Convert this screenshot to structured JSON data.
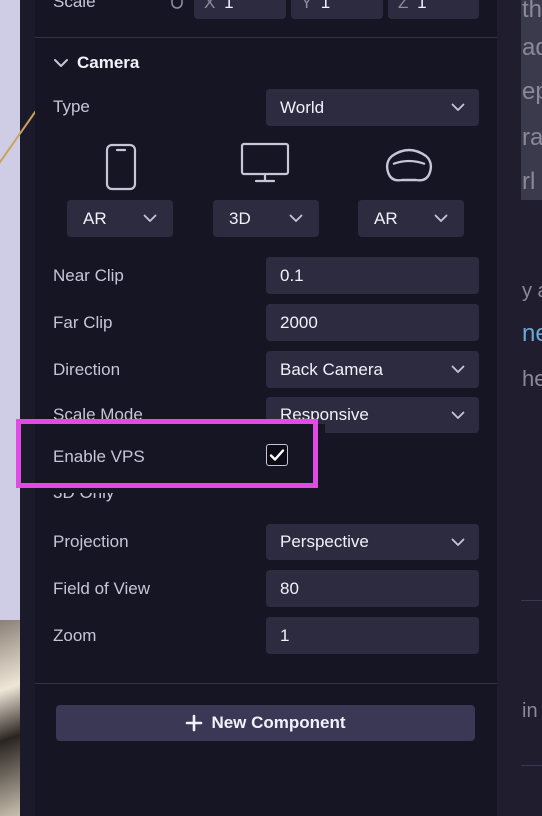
{
  "top_row": {
    "label": "Scale",
    "x_prefix": "X",
    "x_value": "1",
    "y_prefix": "Y",
    "y_value": "1",
    "z_prefix": "Z",
    "z_value": "1"
  },
  "camera": {
    "title": "Camera",
    "type": {
      "label": "Type",
      "value": "World"
    },
    "devices": [
      {
        "icon": "phone-icon",
        "value": "AR"
      },
      {
        "icon": "desktop-icon",
        "value": "3D"
      },
      {
        "icon": "headset-icon",
        "value": "AR"
      }
    ],
    "near_clip": {
      "label": "Near Clip",
      "value": "0.1"
    },
    "far_clip": {
      "label": "Far Clip",
      "value": "2000"
    },
    "direction": {
      "label": "Direction",
      "value": "Back Camera"
    },
    "scale_mode": {
      "label": "Scale Mode",
      "value": "Responsive"
    },
    "enable_vps": {
      "label": "Enable VPS",
      "checked": true
    },
    "section_3d": "3D Only",
    "projection": {
      "label": "Projection",
      "value": "Perspective"
    },
    "fov": {
      "label": "Field of View",
      "value": "80"
    },
    "zoom": {
      "label": "Zoom",
      "value": "1"
    }
  },
  "new_component_label": "New Component",
  "peek": {
    "lines": [
      "th",
      "ad",
      "ep",
      "ra",
      "rl",
      "y a",
      "ne",
      "he",
      "in"
    ]
  },
  "colors": {
    "panel_bg": "#161524",
    "field_bg": "#2d2b40",
    "highlight": "#e24ae6",
    "button_bg": "#3a3854"
  }
}
